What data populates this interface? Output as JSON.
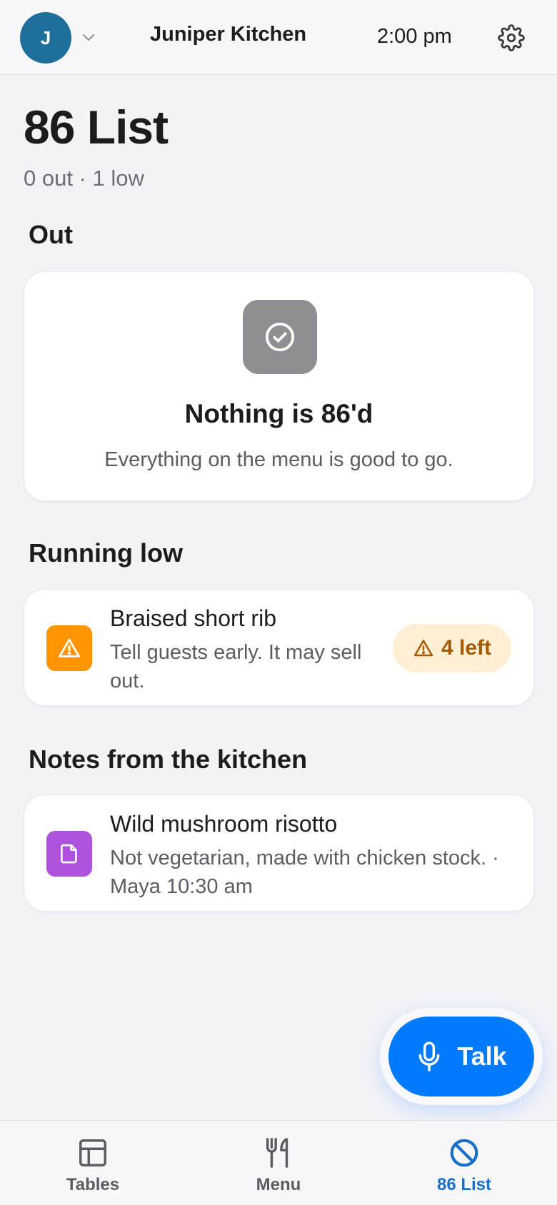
{
  "header": {
    "avatar_initial": "J",
    "kitchen_name": "Juniper Kitchen",
    "time": "2:00 pm"
  },
  "page": {
    "title": "86 List",
    "subtitle": "0 out · 1 low"
  },
  "sections": {
    "out": {
      "heading": "Out",
      "empty_title": "Nothing is 86'd",
      "empty_desc": "Everything on the menu is good to go."
    },
    "running_low": {
      "heading": "Running low",
      "items": [
        {
          "name": "Braised short rib",
          "desc": "Tell guests early. It may sell out.",
          "badge": "4 left"
        }
      ]
    },
    "notes": {
      "heading": "Notes from the kitchen",
      "items": [
        {
          "name": "Wild mushroom risotto",
          "desc": "Not vegetarian, made with chicken stock. · Maya 10:30 am"
        }
      ]
    }
  },
  "fab": {
    "label": "Talk"
  },
  "tabs": [
    {
      "label": "Tables",
      "icon": "table-icon",
      "active": false
    },
    {
      "label": "Menu",
      "icon": "fork-knife-icon",
      "active": false
    },
    {
      "label": "86 List",
      "icon": "prohibited-icon",
      "active": true
    }
  ],
  "colors": {
    "accent": "#007aff",
    "active_tab": "#1a6fc9",
    "avatar": "#1f6f9c",
    "warning": "#ff9500",
    "warning_badge_bg": "#ffefd5",
    "warning_badge_text": "#a55a00",
    "note": "#af52de",
    "empty_icon": "#8e8e93"
  }
}
